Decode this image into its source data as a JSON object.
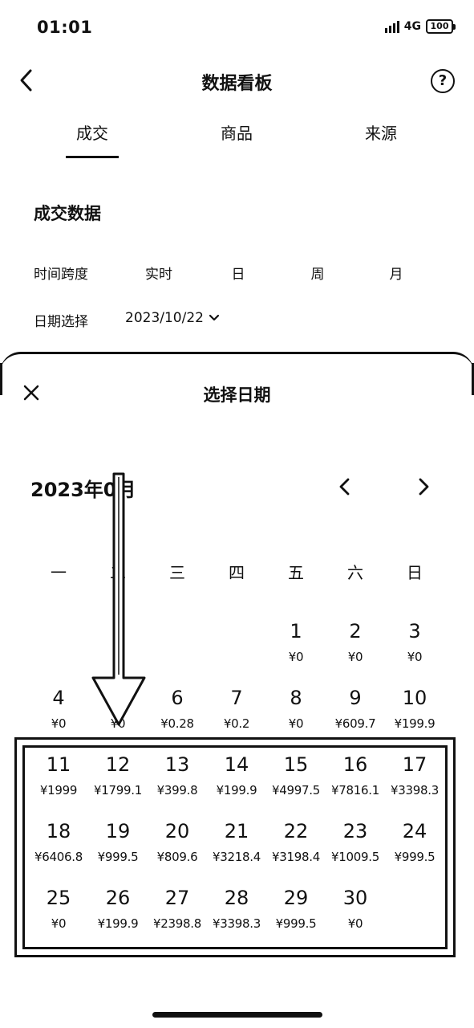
{
  "status": {
    "time": "01:01",
    "network": "4G",
    "battery": "100"
  },
  "header": {
    "title": "数据看板",
    "help": "?"
  },
  "tabs": [
    {
      "label": "成交"
    },
    {
      "label": "商品"
    },
    {
      "label": "来源"
    }
  ],
  "section": {
    "title": "成交数据"
  },
  "time_span": {
    "label": "时间跨度",
    "options": [
      "实时",
      "日",
      "周",
      "月"
    ]
  },
  "date_select": {
    "label": "日期选择",
    "value": "2023/10/22"
  },
  "sheet": {
    "title": "选择日期",
    "month_label": "2023年0月"
  },
  "weekdays": [
    "一",
    "二",
    "三",
    "四",
    "五",
    "六",
    "日"
  ],
  "days": [
    {
      "num": "1",
      "amt": "¥0"
    },
    {
      "num": "2",
      "amt": "¥0"
    },
    {
      "num": "3",
      "amt": "¥0"
    },
    {
      "num": "4",
      "amt": "¥0"
    },
    {
      "num": "5",
      "amt": "¥0"
    },
    {
      "num": "6",
      "amt": "¥0.28"
    },
    {
      "num": "7",
      "amt": "¥0.2"
    },
    {
      "num": "8",
      "amt": "¥0"
    },
    {
      "num": "9",
      "amt": "¥609.7"
    },
    {
      "num": "10",
      "amt": "¥199.9"
    },
    {
      "num": "11",
      "amt": "¥1999"
    },
    {
      "num": "12",
      "amt": "¥1799.1"
    },
    {
      "num": "13",
      "amt": "¥399.8"
    },
    {
      "num": "14",
      "amt": "¥199.9"
    },
    {
      "num": "15",
      "amt": "¥4997.5"
    },
    {
      "num": "16",
      "amt": "¥7816.1"
    },
    {
      "num": "17",
      "amt": "¥3398.3"
    },
    {
      "num": "18",
      "amt": "¥6406.8"
    },
    {
      "num": "19",
      "amt": "¥999.5"
    },
    {
      "num": "20",
      "amt": "¥809.6"
    },
    {
      "num": "21",
      "amt": "¥3218.4"
    },
    {
      "num": "22",
      "amt": "¥3198.4"
    },
    {
      "num": "23",
      "amt": "¥1009.5"
    },
    {
      "num": "24",
      "amt": "¥999.5"
    },
    {
      "num": "25",
      "amt": "¥0"
    },
    {
      "num": "26",
      "amt": "¥199.9"
    },
    {
      "num": "27",
      "amt": "¥2398.8"
    },
    {
      "num": "28",
      "amt": "¥3398.3"
    },
    {
      "num": "29",
      "amt": "¥999.5"
    },
    {
      "num": "30",
      "amt": "¥0"
    }
  ]
}
